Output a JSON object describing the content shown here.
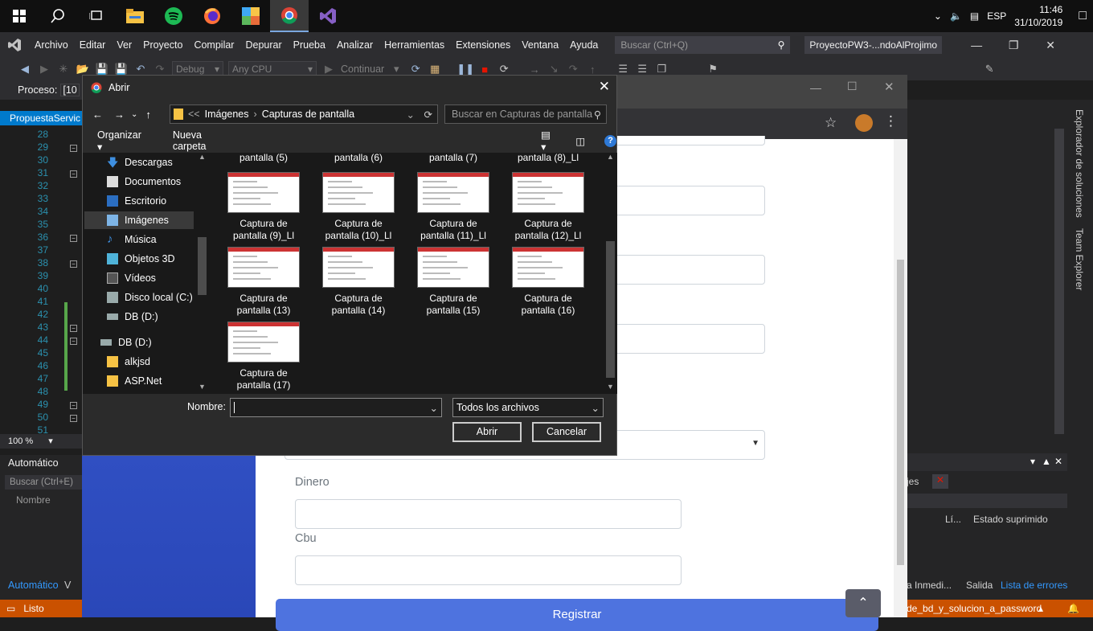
{
  "taskbar": {
    "lang": "ESP",
    "time": "11:46",
    "date": "31/10/2019"
  },
  "vs": {
    "menu": [
      "Archivo",
      "Editar",
      "Ver",
      "Proyecto",
      "Compilar",
      "Depurar",
      "Prueba",
      "Analizar",
      "Herramientas",
      "Extensiones",
      "Ventana",
      "Ayuda"
    ],
    "search_placeholder": "Buscar (Ctrl+Q)",
    "window_title": "ProyectoPW3-...ndoAlProjimo",
    "config": "Debug",
    "platform": "Any CPU",
    "continue": "Continuar",
    "proc_label": "Proceso:",
    "proc_value": "[10",
    "doc_tab": "PropuestaServic",
    "line_numbers": [
      "28",
      "29",
      "30",
      "31",
      "32",
      "33",
      "34",
      "35",
      "36",
      "37",
      "38",
      "39",
      "40",
      "41",
      "42",
      "43",
      "44",
      "45",
      "46",
      "47",
      "48",
      "49",
      "50",
      "51"
    ],
    "zoom": "100 %",
    "auto_title": "Automático",
    "auto_search": "Buscar (Ctrl+E)",
    "auto_col": "Nombre",
    "auto_tab": "Automático",
    "auto_tab2": "V",
    "status": "Listo",
    "sol_explorer": "Explorador de soluciones",
    "team_explorer": "Team Explorer",
    "right_msgs": "jes",
    "right_col_li": "Lí...",
    "right_col_state": "Estado suprimido",
    "right_tab1": "a Inmedi...",
    "right_tab2": "Salida",
    "right_tab3": "Lista de errores",
    "branch": "de_bd_y_solucion_a_password"
  },
  "page": {
    "label_dinero": "Dinero",
    "label_cbu": "Cbu",
    "register": "Registrar"
  },
  "dialog": {
    "title": "Abrir",
    "path": [
      "Imágenes",
      "Capturas de pantalla"
    ],
    "search_placeholder": "Buscar en Capturas de pantalla",
    "organize": "Organizar",
    "new_folder": "Nueva carpeta",
    "tree": [
      "Descargas",
      "Documentos",
      "Escritorio",
      "Imágenes",
      "Música",
      "Objetos 3D",
      "Vídeos",
      "Disco local (C:)",
      "DB (D:)",
      "DB (D:)",
      "alkjsd",
      "ASP.Net"
    ],
    "files_top": [
      "pantalla (5)",
      "pantalla (6)",
      "pantalla (7)",
      "pantalla (8)_Ll"
    ],
    "files": [
      [
        "Captura de",
        "pantalla (9)_Ll"
      ],
      [
        "Captura de",
        "pantalla (10)_Ll"
      ],
      [
        "Captura de",
        "pantalla (11)_Ll"
      ],
      [
        "Captura de",
        "pantalla (12)_Ll"
      ],
      [
        "Captura de",
        "pantalla (13)"
      ],
      [
        "Captura de",
        "pantalla (14)"
      ],
      [
        "Captura de",
        "pantalla (15)"
      ],
      [
        "Captura de",
        "pantalla (16)"
      ],
      [
        "Captura de",
        "pantalla (17)"
      ]
    ],
    "name_label": "Nombre:",
    "name_value": "",
    "filter": "Todos los archivos",
    "open_btn": "Abrir",
    "cancel_btn": "Cancelar"
  }
}
